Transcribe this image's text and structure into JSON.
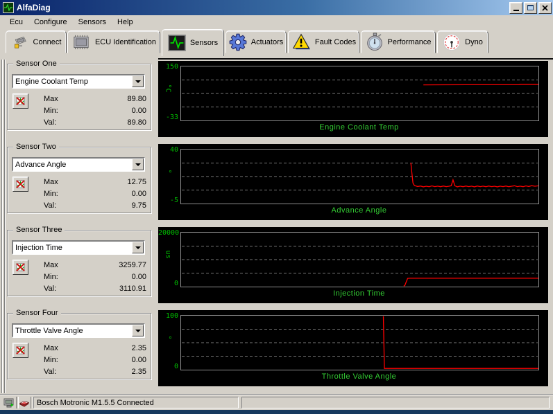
{
  "window": {
    "title": "AlfaDiag"
  },
  "menu": {
    "items": [
      {
        "label": "Ecu"
      },
      {
        "label": "Configure"
      },
      {
        "label": "Sensors"
      },
      {
        "label": "Help"
      }
    ]
  },
  "tabs": [
    {
      "label": "Connect",
      "icon": "connector-icon",
      "active": false
    },
    {
      "label": "ECU Identification",
      "icon": "chip-icon",
      "active": false
    },
    {
      "label": "Sensors",
      "icon": "oscilloscope-icon",
      "active": true
    },
    {
      "label": "Actuators",
      "icon": "gear-icon",
      "active": false
    },
    {
      "label": "Fault Codes",
      "icon": "warning-icon",
      "active": false
    },
    {
      "label": "Performance",
      "icon": "stopwatch-icon",
      "active": false
    },
    {
      "label": "Dyno",
      "icon": "gauge-icon",
      "active": false
    }
  ],
  "sensors": [
    {
      "group_label": "Sensor One",
      "selected": "Engine Coolant Temp",
      "max_label": "Max",
      "min_label": "Min:",
      "val_label": "Val:",
      "max": "89.80",
      "min": "0.00",
      "val": "89.80"
    },
    {
      "group_label": "Sensor Two",
      "selected": "Advance Angle",
      "max_label": "Max",
      "min_label": "Min:",
      "val_label": "Val:",
      "max": "12.75",
      "min": "0.00",
      "val": "9.75"
    },
    {
      "group_label": "Sensor Three",
      "selected": "Injection Time",
      "max_label": "Max",
      "min_label": "Min:",
      "val_label": "Val:",
      "max": "3259.77",
      "min": "0.00",
      "val": "3110.91"
    },
    {
      "group_label": "Sensor Four",
      "selected": "Throttle Valve Angle",
      "max_label": "Max",
      "min_label": "Min:",
      "val_label": "Val:",
      "max": "2.35",
      "min": "0.00",
      "val": "2.35"
    }
  ],
  "status": {
    "text": "Bosch Motronic M1.5.5 Connected"
  },
  "colors": {
    "chart_text_green": "#33cc33",
    "tick_green": "#00c000",
    "line_red": "#ff0000",
    "titlebar_left": "#0a246a",
    "titlebar_right": "#a6caf0"
  },
  "chart_data": [
    {
      "type": "line",
      "title": "Engine Coolant Temp",
      "y_unit": "°C",
      "y_top_label": "150",
      "y_bottom_label": "-33",
      "ylim": [
        -33,
        150
      ],
      "grid": "horizontal-dashed-quarters",
      "legend": "none",
      "series": [
        {
          "name": "Engine Coolant Temp",
          "color": "#ff0000",
          "points": [
            [
              67.8,
              87.5
            ],
            [
              80,
              88
            ],
            [
              94.5,
              88
            ],
            [
              95,
              89.8
            ],
            [
              100,
              89.8
            ]
          ]
        }
      ]
    },
    {
      "type": "line",
      "title": "Advance Angle",
      "y_unit": "°",
      "y_top_label": "40",
      "y_bottom_label": "-5",
      "ylim": [
        -5,
        40
      ],
      "grid": "horizontal-dashed-quarters",
      "legend": "none",
      "series": [
        {
          "name": "Advance Angle",
          "color": "#ff0000",
          "points": [
            [
              64.3,
              29
            ],
            [
              64.6,
              20
            ],
            [
              64.9,
              12
            ],
            [
              65.3,
              10
            ],
            [
              66.2,
              9.2
            ],
            [
              67,
              9.6
            ],
            [
              67.8,
              8.9
            ],
            [
              68.6,
              9.4
            ],
            [
              69.4,
              9.0
            ],
            [
              70.2,
              9.7
            ],
            [
              71,
              9.1
            ],
            [
              71.8,
              9.5
            ],
            [
              72.6,
              9.0
            ],
            [
              73.4,
              9.6
            ],
            [
              74.2,
              9.1
            ],
            [
              75,
              9.4
            ],
            [
              75.6,
              9.8
            ],
            [
              76.1,
              14.8
            ],
            [
              76.6,
              9.8
            ],
            [
              77.3,
              8.9
            ],
            [
              78.1,
              9.5
            ],
            [
              78.9,
              9.0
            ],
            [
              79.7,
              9.6
            ],
            [
              80.5,
              9.1
            ],
            [
              81.3,
              9.5
            ],
            [
              82.1,
              8.9
            ],
            [
              82.9,
              9.6
            ],
            [
              83.7,
              9.1
            ],
            [
              84.5,
              9.5
            ],
            [
              85.3,
              9.0
            ],
            [
              86.1,
              9.6
            ],
            [
              86.9,
              9.1
            ],
            [
              87.7,
              9.4
            ],
            [
              88.5,
              8.9
            ],
            [
              89.3,
              9.5
            ],
            [
              90.1,
              9.1
            ],
            [
              90.9,
              9.6
            ],
            [
              91.7,
              9.0
            ],
            [
              92.5,
              9.4
            ],
            [
              93.3,
              9.8
            ],
            [
              94.1,
              9.1
            ],
            [
              94.9,
              9.5
            ],
            [
              95.7,
              9.0
            ],
            [
              96.5,
              9.7
            ],
            [
              97.3,
              9.2
            ],
            [
              98.1,
              9.9
            ],
            [
              99,
              9.4
            ],
            [
              100,
              9.75
            ]
          ]
        }
      ]
    },
    {
      "type": "line",
      "title": "Injection Time",
      "y_unit": "us",
      "y_top_label": "20000",
      "y_bottom_label": "0",
      "ylim": [
        0,
        20000
      ],
      "grid": "horizontal-dashed-quarters",
      "legend": "none",
      "series": [
        {
          "name": "Injection Time",
          "color": "#ff0000",
          "points": [
            [
              62.3,
              0
            ],
            [
              62.6,
              400
            ],
            [
              63.4,
              3050
            ],
            [
              64,
              3110
            ],
            [
              100,
              3110.91
            ]
          ]
        }
      ]
    },
    {
      "type": "line",
      "title": "Throttle Valve Angle",
      "y_unit": "°",
      "y_top_label": "100",
      "y_bottom_label": "0",
      "ylim": [
        0,
        100
      ],
      "grid": "horizontal-dashed-quarters",
      "legend": "none",
      "series": [
        {
          "name": "Throttle Valve Angle",
          "color": "#ff0000",
          "points": [
            [
              56.6,
              100
            ],
            [
              56.9,
              2.35
            ],
            [
              100,
              2.35
            ]
          ]
        }
      ]
    }
  ]
}
